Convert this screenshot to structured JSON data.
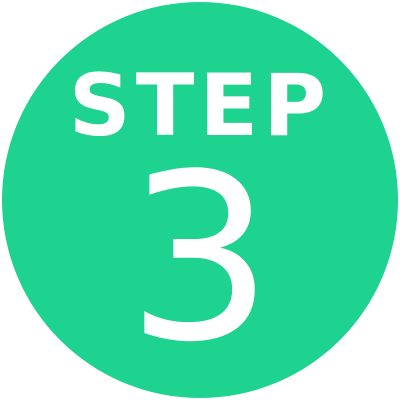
{
  "badge": {
    "label": "STEP",
    "number": "3",
    "background_color": "#1ed28f",
    "text_color": "#ffffff"
  }
}
